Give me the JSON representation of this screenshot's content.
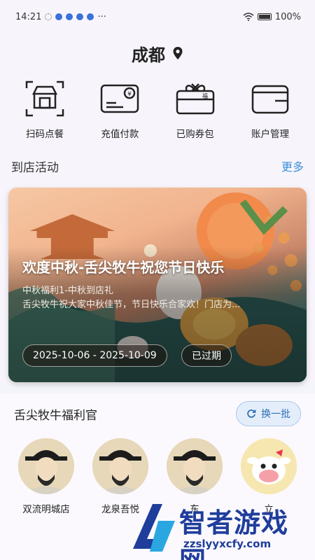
{
  "status": {
    "time": "14:21",
    "battery": "100%"
  },
  "header": {
    "city": "成都"
  },
  "quick_actions": [
    {
      "label": "扫码点餐",
      "icon": "scan-order-icon"
    },
    {
      "label": "充值付款",
      "icon": "card-pay-icon"
    },
    {
      "label": "已购券包",
      "icon": "gift-coupon-icon"
    },
    {
      "label": "账户管理",
      "icon": "wallet-icon"
    }
  ],
  "activities": {
    "title": "到店活动",
    "more": "更多",
    "banner": {
      "title": "欢度中秋-舌尖牧牛祝您节日快乐",
      "subtitle": "中秋福利1-中秋到店礼",
      "desc": "舌尖牧牛祝大家中秋佳节，节日快乐合家欢！门店为...",
      "date_range": "2025-10-06 - 2025-10-09",
      "status": "已过期"
    }
  },
  "welfare": {
    "title": "舌尖牧牛福利官",
    "refresh": "换一批",
    "stores": [
      {
        "name": "双流明城店"
      },
      {
        "name": "龙泉吾悦"
      },
      {
        "name": "东"
      },
      {
        "name": "立"
      }
    ]
  },
  "watermark": {
    "text": "智者游戏网",
    "url": "zzslyyxcfy.com"
  },
  "colors": {
    "accent": "#3a8fd9",
    "watermark": "#1f3d9b"
  }
}
